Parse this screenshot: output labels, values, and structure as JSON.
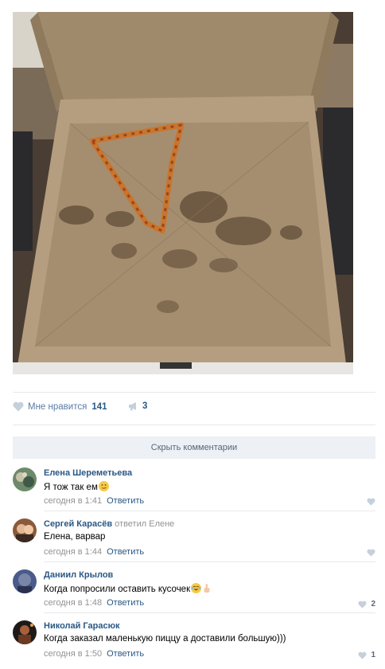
{
  "post": {
    "likes_label": "Мне нравится",
    "likes_count": "141",
    "shares_count": "3",
    "photo_icon": "pizza-box-photo"
  },
  "comments_toggle": "Скрыть комментарии",
  "comments": [
    {
      "author": "Елена Шереметьева",
      "reply_prefix": "",
      "reply_to": "",
      "text": "Я тож так ем",
      "emoji": [
        "smirk-face-emoji"
      ],
      "time": "сегодня в 1:41",
      "reply_label": "Ответить",
      "likes": ""
    },
    {
      "author": "Сергей Карасёв",
      "reply_prefix": "ответил",
      "reply_to": "Елене",
      "text": "Елена, варвар",
      "emoji": [],
      "time": "сегодня в 1:44",
      "reply_label": "Ответить",
      "likes": ""
    },
    {
      "author": "Даниил Крылов",
      "reply_prefix": "",
      "reply_to": "",
      "text": "Когда попросили оставить кусочек",
      "emoji": [
        "tears-of-joy-emoji",
        "pointing-up-emoji"
      ],
      "time": "сегодня в 1:48",
      "reply_label": "Ответить",
      "likes": "2"
    },
    {
      "author": "Николай Гарасюк",
      "reply_prefix": "",
      "reply_to": "",
      "text": "Когда заказал маленькую пиццу а доставили большую)))",
      "emoji": [],
      "time": "сегодня в 1:50",
      "reply_label": "Ответить",
      "likes": "1"
    }
  ]
}
